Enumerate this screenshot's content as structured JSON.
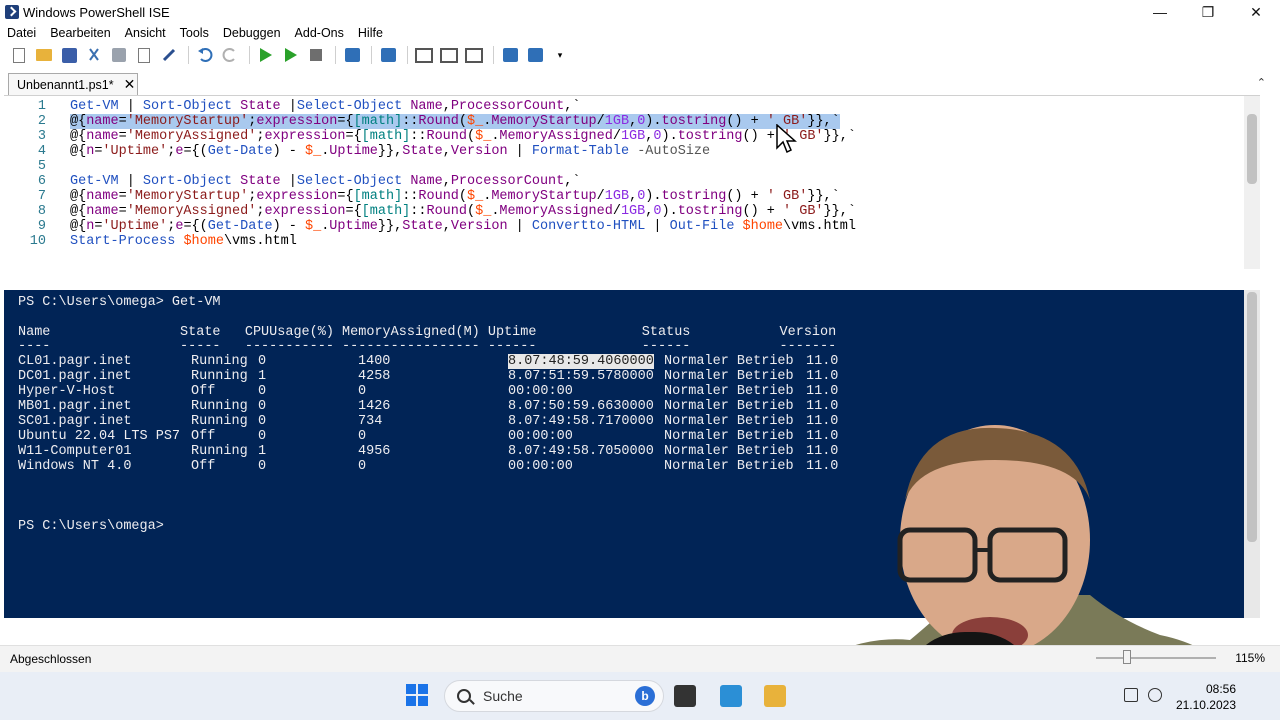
{
  "window": {
    "title": "Windows PowerShell ISE"
  },
  "menu": [
    "Datei",
    "Bearbeiten",
    "Ansicht",
    "Tools",
    "Debuggen",
    "Add-Ons",
    "Hilfe"
  ],
  "toolbar_icons": [
    "new-file-icon",
    "open-icon",
    "save-icon",
    "cut-icon",
    "copy-icon",
    "paste-icon",
    "clear-icon",
    "undo-icon",
    "redo-icon",
    "run-script-icon",
    "run-selection-icon",
    "stop-icon",
    "new-remote-tab-icon",
    "start-powershell-icon",
    "show-script-top-icon",
    "show-script-right-icon",
    "show-script-max-icon",
    "show-commands-icon",
    "show-addon-icon"
  ],
  "tab": {
    "label": "Unbenannt1.ps1*"
  },
  "editor": {
    "line_numbers": [
      "1",
      "2",
      "3",
      "4",
      "5",
      "6",
      "7",
      "8",
      "9",
      "10"
    ]
  },
  "console": {
    "prompt_line": "PS C:\\Users\\omega> Get-VM",
    "header": "Name                State   CPUUsage(%) MemoryAssigned(M) Uptime             Status           Version",
    "underline": "----                -----   ----------- ----------------- ------             ------           -------",
    "rows": [
      {
        "name": "CL01.pagr.inet",
        "state": "Running",
        "cpu": "0",
        "mem": "1400",
        "uptime": "8.07:48:59.4060000",
        "status": "Normaler Betrieb",
        "version": "11.0"
      },
      {
        "name": "DC01.pagr.inet",
        "state": "Running",
        "cpu": "1",
        "mem": "4258",
        "uptime": "8.07:51:59.5780000",
        "status": "Normaler Betrieb",
        "version": "11.0"
      },
      {
        "name": "Hyper-V-Host",
        "state": "Off",
        "cpu": "0",
        "mem": "0",
        "uptime": "00:00:00",
        "status": "Normaler Betrieb",
        "version": "11.0"
      },
      {
        "name": "MB01.pagr.inet",
        "state": "Running",
        "cpu": "0",
        "mem": "1426",
        "uptime": "8.07:50:59.6630000",
        "status": "Normaler Betrieb",
        "version": "11.0"
      },
      {
        "name": "SC01.pagr.inet",
        "state": "Running",
        "cpu": "0",
        "mem": "734",
        "uptime": "8.07:49:58.7170000",
        "status": "Normaler Betrieb",
        "version": "11.0"
      },
      {
        "name": "Ubuntu 22.04 LTS PS7",
        "state": "Off",
        "cpu": "0",
        "mem": "0",
        "uptime": "00:00:00",
        "status": "Normaler Betrieb",
        "version": "11.0"
      },
      {
        "name": "W11-Computer01",
        "state": "Running",
        "cpu": "1",
        "mem": "4956",
        "uptime": "8.07:49:58.7050000",
        "status": "Normaler Betrieb",
        "version": "11.0"
      },
      {
        "name": "Windows NT 4.0",
        "state": "Off",
        "cpu": "0",
        "mem": "0",
        "uptime": "00:00:00",
        "status": "Normaler Betrieb",
        "version": "11.0"
      }
    ],
    "final_prompt": "PS C:\\Users\\omega>"
  },
  "statusbar": {
    "text": "Abgeschlossen",
    "zoom": "115%"
  },
  "taskbar": {
    "search_placeholder": "Suche",
    "time": "08:56",
    "date": "21.10.2023"
  },
  "colors": {
    "console_bg": "#012456",
    "selection": "#a9c9ee",
    "keyword": "#2050c0",
    "string": "#8b1a1a",
    "variable": "#ff4500"
  }
}
